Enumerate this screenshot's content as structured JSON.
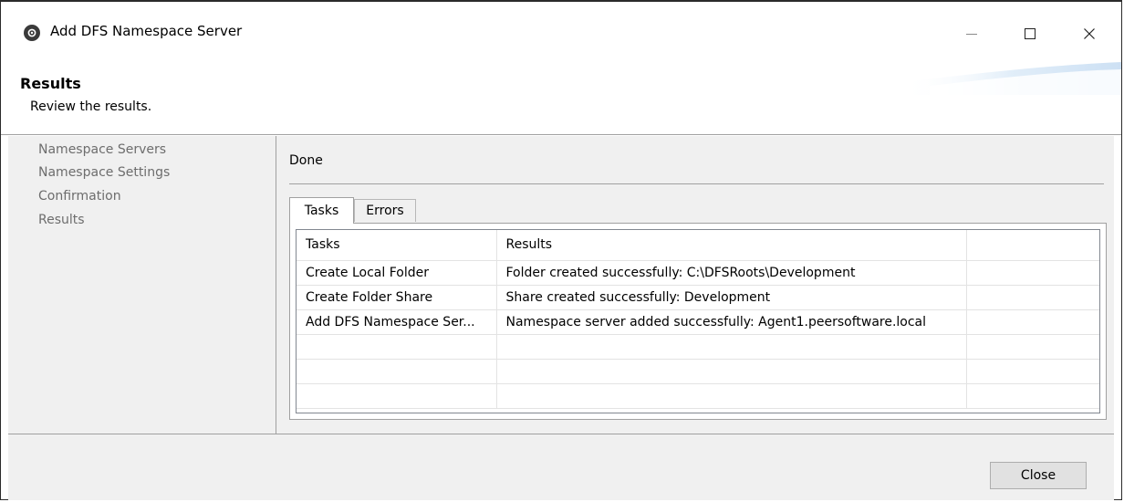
{
  "window": {
    "title": "Add DFS Namespace Server",
    "icons": {
      "app": "peer-logo-icon",
      "minimize": "minimize-icon",
      "maximize": "maximize-icon",
      "close": "close-icon"
    }
  },
  "header": {
    "title": "Results",
    "subtitle": "Review the results."
  },
  "nav": {
    "items": [
      {
        "label": "Namespace Servers"
      },
      {
        "label": "Namespace Settings"
      },
      {
        "label": "Confirmation"
      },
      {
        "label": "Results"
      }
    ]
  },
  "content": {
    "status": "Done",
    "tabs": [
      {
        "label": "Tasks",
        "active": true
      },
      {
        "label": "Errors",
        "active": false
      }
    ],
    "table": {
      "columns": [
        "Tasks",
        "Results",
        ""
      ],
      "rows": [
        [
          "Create Local Folder",
          "Folder created successfully: C:\\DFSRoots\\Development",
          ""
        ],
        [
          "Create Folder Share",
          "Share created successfully: Development",
          ""
        ],
        [
          "Add DFS Namespace Ser...",
          "Namespace server added successfully: Agent1.peersoftware.local",
          ""
        ],
        [
          "",
          "",
          ""
        ],
        [
          "",
          "",
          ""
        ],
        [
          "",
          "",
          ""
        ]
      ]
    }
  },
  "footer": {
    "close_label": "Close"
  }
}
